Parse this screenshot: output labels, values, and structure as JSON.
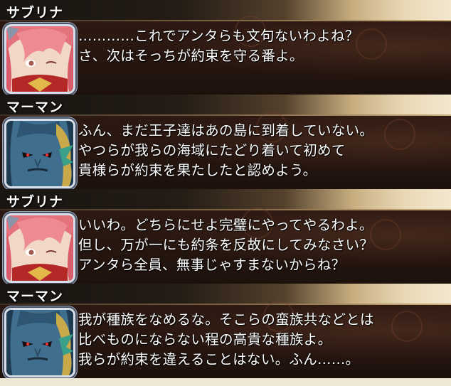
{
  "dialogue_log": [
    {
      "speaker": "サブリナ",
      "portrait_icon": "sabrina-portrait",
      "lines": [
        "…………これでアンタらも文句ないわよね？",
        "さ、次はそっちが約束を守る番よ。"
      ]
    },
    {
      "speaker": "マーマン",
      "portrait_icon": "merman-portrait",
      "lines": [
        "ふん、まだ王子達はあの島に到着していない。",
        "やつらが我らの海域にたどり着いて初めて",
        "貴様らが約束を果たしたと認めよう。"
      ]
    },
    {
      "speaker": "サブリナ",
      "portrait_icon": "sabrina-portrait",
      "lines": [
        "いいわ。どちらにせよ完璧にやってやるわよ。",
        "但し、万が一にも約条を反故にしてみなさい？",
        "アンタら全員、無事じゃすまないからね？"
      ]
    },
    {
      "speaker": "マーマン",
      "portrait_icon": "merman-portrait",
      "lines": [
        "我が種族をなめるな。そこらの蛮族共などとは",
        "比べものにならない程の高貴な種族よ。",
        "我らが約束を違えることはない。ふん……。"
      ]
    }
  ],
  "colors": {
    "dialogue_text": "#ffffff",
    "panel_background": "#25150f",
    "name_bar_dark": "#191512",
    "name_bar_light": "#ead9b7",
    "portrait_frame": "#d8dfe8"
  }
}
